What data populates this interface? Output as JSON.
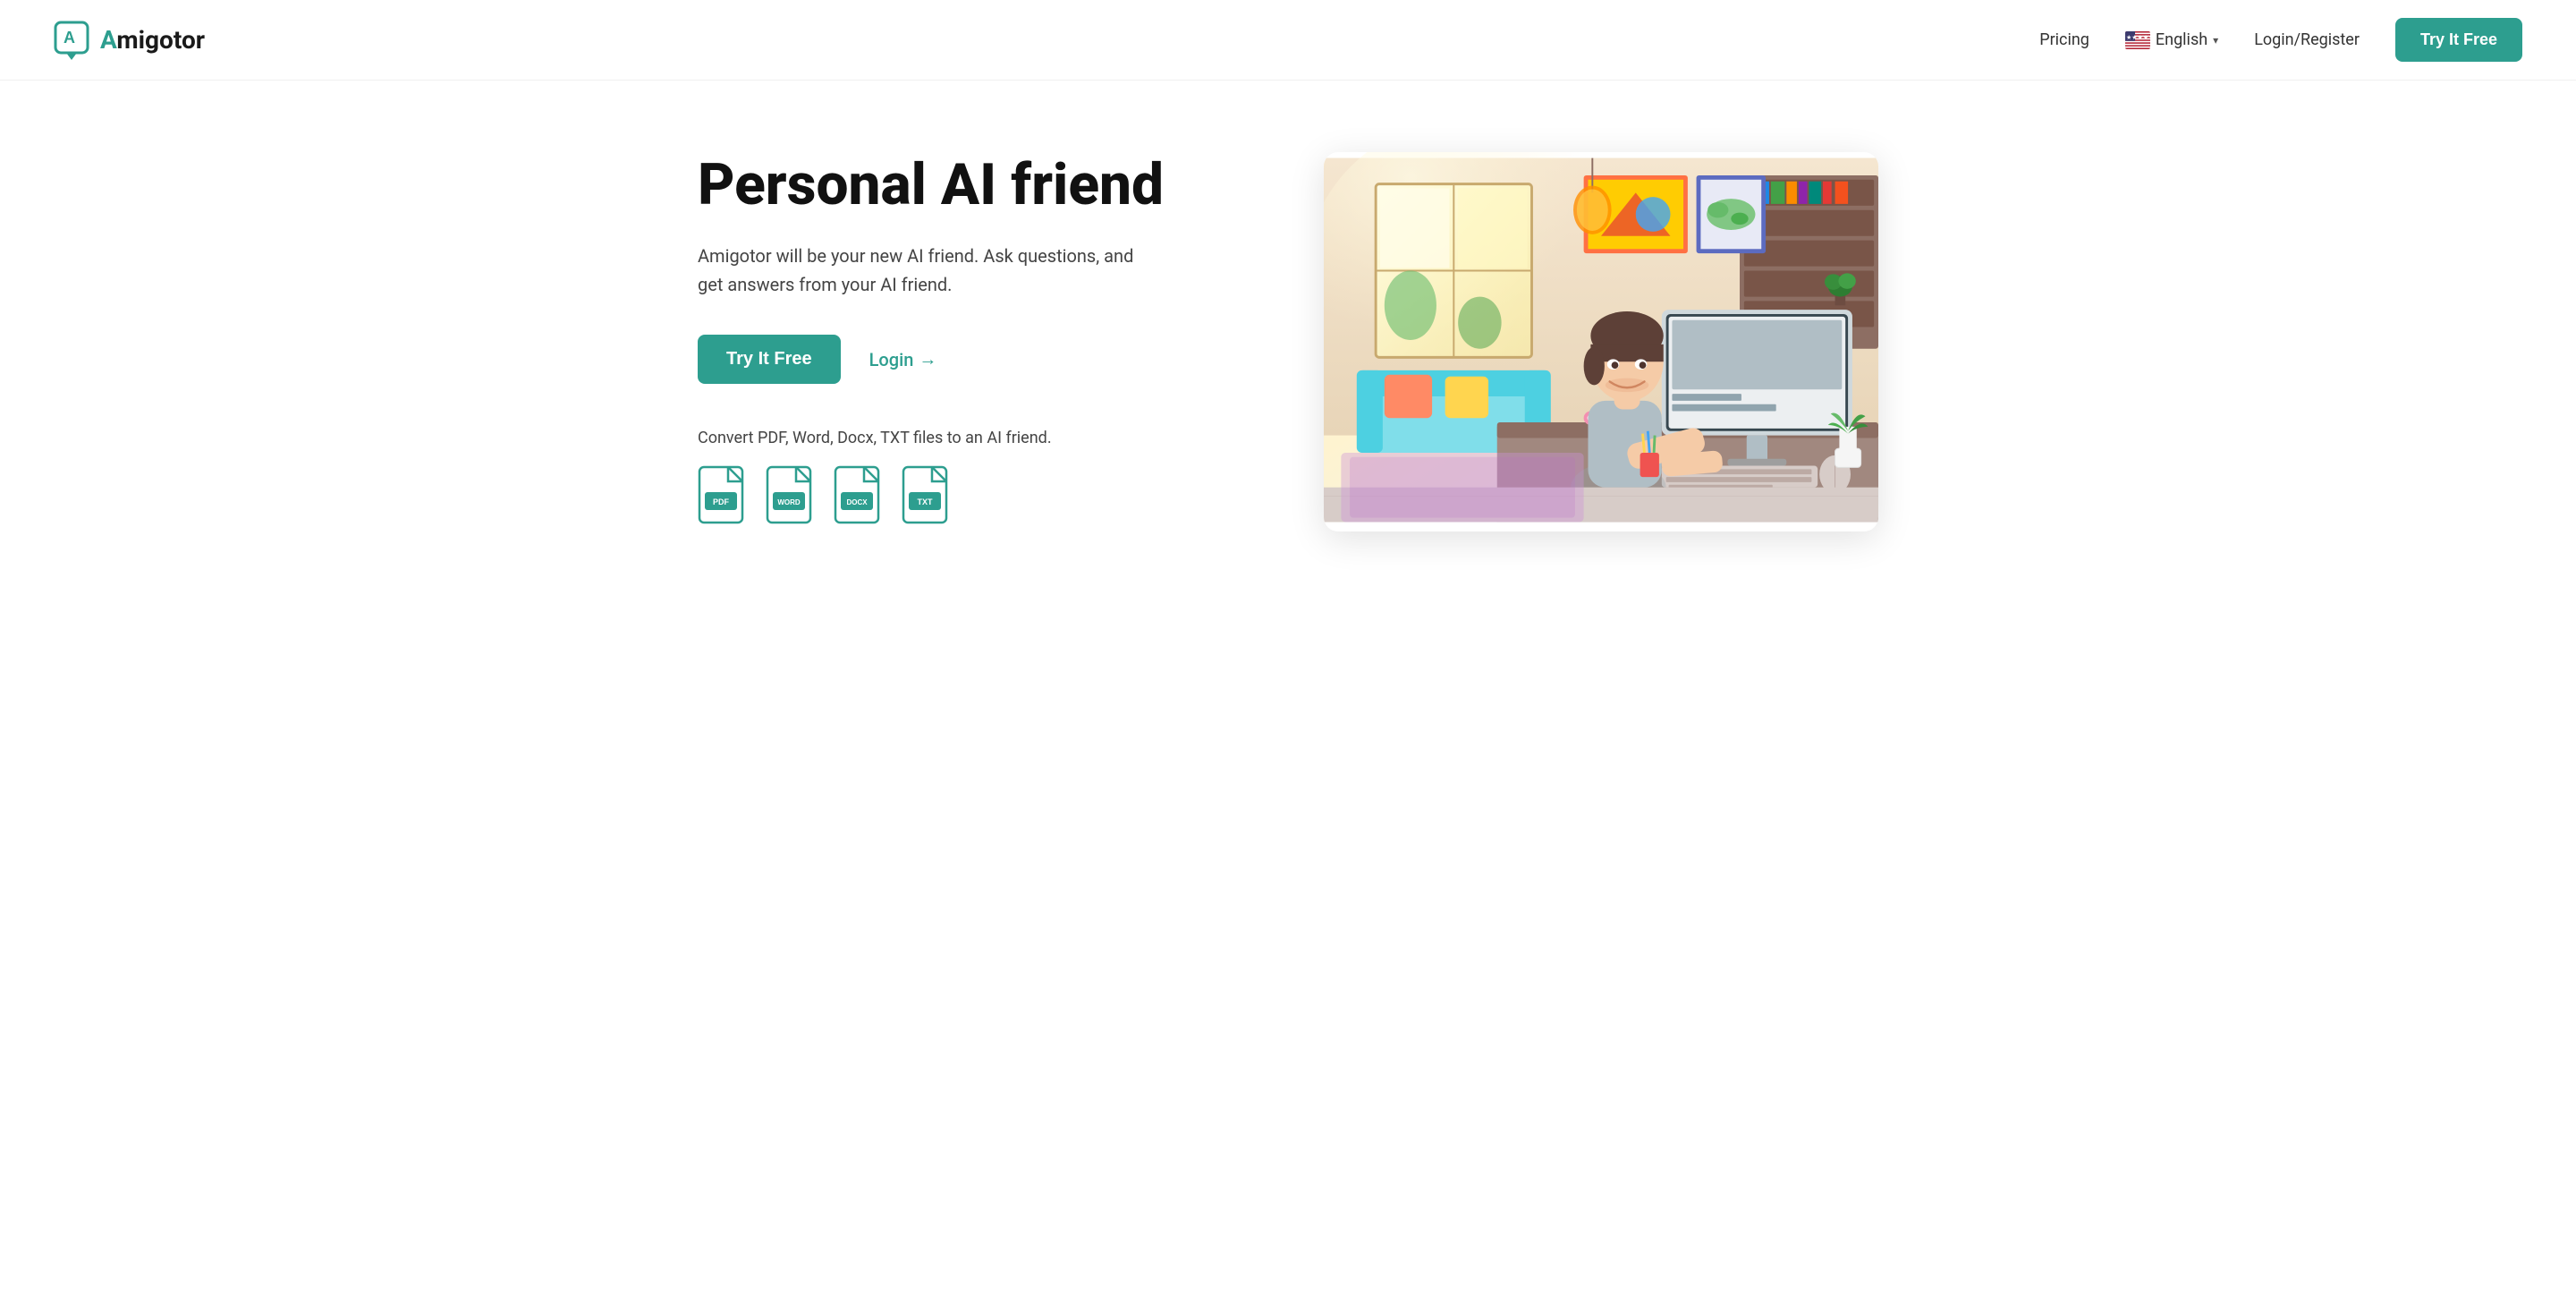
{
  "logo": {
    "icon_letter": "A",
    "brand_name_teal": "A",
    "brand_name_rest": "migotor"
  },
  "navbar": {
    "pricing_label": "Pricing",
    "language_label": "English",
    "language_flag": "us",
    "login_register_label": "Login/Register",
    "try_it_free_label": "Try It Free"
  },
  "hero": {
    "title": "Personal AI friend",
    "subtitle": "Amigotor will be your new AI friend. Ask questions, and get answers from your AI friend.",
    "try_button_label": "Try It Free",
    "login_label": "Login",
    "login_arrow": "→",
    "convert_text": "Convert PDF, Word, Docx, TXT files to an AI friend.",
    "file_types": [
      {
        "label": "PDF",
        "id": "pdf"
      },
      {
        "label": "WORD",
        "id": "word"
      },
      {
        "label": "DOCX",
        "id": "docx"
      },
      {
        "label": "TXT",
        "id": "txt"
      }
    ]
  },
  "colors": {
    "teal": "#2d9e8f",
    "teal_dark": "#267f73",
    "text_dark": "#111111",
    "text_mid": "#444444",
    "white": "#ffffff"
  }
}
